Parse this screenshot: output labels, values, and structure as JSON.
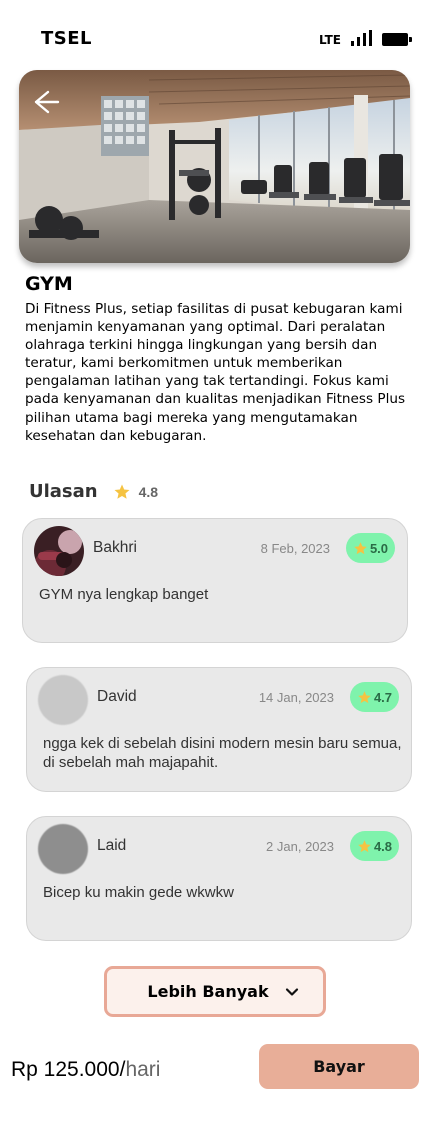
{
  "status_bar": {
    "carrier": "TSEL",
    "network": "LTE"
  },
  "facility": {
    "title": "GYM",
    "description": "Di Fitness Plus, setiap fasilitas di pusat kebugaran kami menjamin kenyamanan yang optimal. Dari peralatan olahraga terkini hingga lingkungan yang bersih dan teratur, kami berkomitmen untuk memberikan pengalaman latihan yang tak tertandingi. Fokus kami pada kenyamanan dan kualitas menjadikan Fitness Plus pilihan utama bagi mereka yang mengutamakan kesehatan dan kebugaran."
  },
  "reviews": {
    "label": "Ulasan",
    "average": "4.8",
    "items": [
      {
        "name": "Bakhri",
        "date": "8 Feb, 2023",
        "rating": "5.0",
        "comment": "GYM nya lengkap banget"
      },
      {
        "name": "David",
        "date": "14 Jan, 2023",
        "rating": "4.7",
        "comment": "ngga kek di sebelah disini modern mesin baru semua, di sebelah mah majapahit."
      },
      {
        "name": "Laid",
        "date": "2 Jan, 2023",
        "rating": "4.8",
        "comment": "Bicep ku makin gede wkwkw"
      }
    ],
    "more_label": "Lebih Banyak"
  },
  "checkout": {
    "price": "Rp 125.000/",
    "unit": "hari",
    "pay_label": "Bayar"
  },
  "colors": {
    "badge_bg": "#7ff3ac",
    "star": "#f5c342",
    "accent": "#e8ae98",
    "card_bg": "#e9e9e9"
  },
  "icons": [
    "back-arrow-icon",
    "star-icon",
    "chevron-down-icon",
    "signal-icon",
    "battery-icon"
  ]
}
